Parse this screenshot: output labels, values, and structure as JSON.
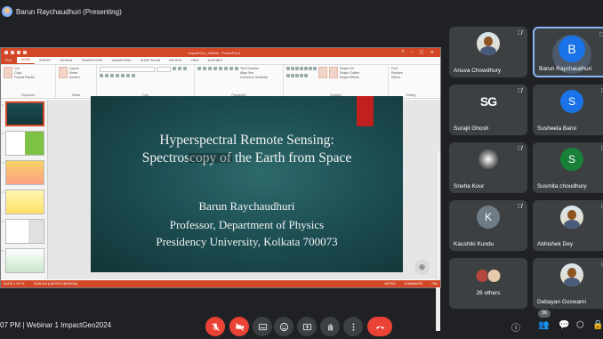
{
  "presenter": {
    "label": "Barun Raychaudhuri (Presenting)"
  },
  "powerpoint": {
    "window_title": "ImpactGeo_Zbfab8 - PowerPoint",
    "tabs": [
      "FILE",
      "HOME",
      "INSERT",
      "DESIGN",
      "TRANSITIONS",
      "ANIMATIONS",
      "SLIDE SHOW",
      "REVIEW",
      "VIEW",
      "ACROBAT"
    ],
    "ribbon": {
      "clipboard": {
        "label": "Clipboard",
        "items": [
          "Cut",
          "Copy",
          "Format Painter"
        ],
        "paste": "Paste"
      },
      "slides": {
        "label": "Slides",
        "items": [
          "Layout",
          "Reset",
          "Section"
        ],
        "new": "New Slide"
      },
      "font": {
        "label": "Font"
      },
      "paragraph": {
        "label": "Paragraph",
        "items": [
          "Text Direction",
          "Align Text",
          "Convert to SmartArt"
        ]
      },
      "drawing": {
        "label": "Drawing",
        "items": [
          "Shape Fill",
          "Shape Outline",
          "Shape Effects"
        ],
        "arrange": "Arrange",
        "quick": "Quick Styles"
      },
      "editing": {
        "label": "Editing",
        "items": [
          "Find",
          "Replace",
          "Select"
        ]
      }
    },
    "slide": {
      "title_line1": "Hyperspectral Remote Sensing:",
      "title_line2": "Spectroscopy of the Earth from Space",
      "author": "Barun Raychaudhuri",
      "position": "Professor, Department of Physics",
      "affiliation": "Presidency University, Kolkata 700073"
    },
    "status": {
      "slide": "SLIDE 1 OF 47",
      "language": "ENGLISH (UNITED KINGDOM)",
      "notes": "NOTES",
      "comments": "COMMENTS",
      "zoom": "74%"
    },
    "thumb_numbers": [
      "1",
      "2",
      "3",
      "4",
      "5",
      "6"
    ]
  },
  "participants": [
    {
      "name": "Anuva Chowdhury",
      "initials": "",
      "muted": true
    },
    {
      "name": "Barun Raychaudhuri",
      "initials": "B",
      "muted": true,
      "speaking": true
    },
    {
      "name": "Surajit Ghosh",
      "initials": "SG",
      "muted": true
    },
    {
      "name": "Susheela Baroi",
      "initials": "S",
      "muted": true
    },
    {
      "name": "Sneha Kour",
      "initials": "",
      "muted": true
    },
    {
      "name": "Susmita choudhury",
      "initials": "S",
      "muted": true
    },
    {
      "name": "Kaushiki Kundu",
      "initials": "K",
      "muted": true
    },
    {
      "name": "Abhishek Dey",
      "initials": "",
      "muted": true
    },
    {
      "name": "26 others",
      "initials": "",
      "muted": false
    },
    {
      "name": "Debayan Goswami",
      "initials": "",
      "muted": true
    }
  ],
  "colors": {
    "S_blue": "#1a73e8",
    "S_green": "#188038",
    "K_gray": "#6f7b85",
    "B_blue": "#1a73e8",
    "end_call": "#ea4335",
    "ppt_accent": "#d24726"
  },
  "meeting": {
    "time_and_title": "07 PM  |  Webinar 1 ImpactGeo2024",
    "participant_count": "36"
  },
  "controls": [
    "mic-off",
    "camera-off",
    "captions",
    "emoji",
    "present",
    "raise-hand",
    "more",
    "end-call"
  ],
  "right_controls": [
    "info",
    "people",
    "chat",
    "activities",
    "lock"
  ]
}
